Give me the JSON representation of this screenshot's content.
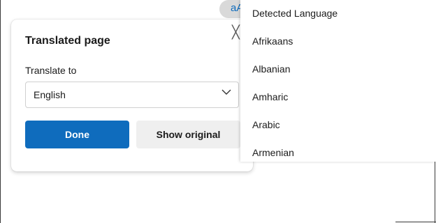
{
  "translate_button": {
    "glyph": "aA",
    "icon": "translate-icon"
  },
  "panel": {
    "title": "Translated page",
    "translate_to_label": "Translate to",
    "selected_language": "English",
    "done_label": "Done",
    "show_original_label": "Show original",
    "close_glyph": "╳"
  },
  "language_list": {
    "items": [
      "Detected Language",
      "Afrikaans",
      "Albanian",
      "Amharic",
      "Arabic",
      "Armenian"
    ]
  },
  "colors": {
    "accent": "#0f6cbd",
    "secondary_button": "#efefef"
  }
}
